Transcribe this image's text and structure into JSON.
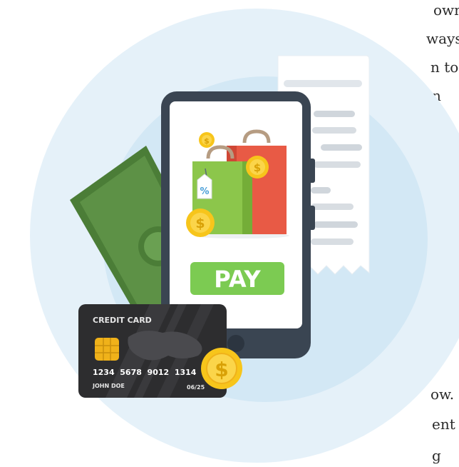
{
  "text_fragments": [
    "own",
    "ways",
    "n to",
    "n",
    "ow.",
    "ent",
    "g"
  ],
  "illustration": {
    "pay_button_label": "PAY",
    "card": {
      "title": "CREDIT CARD",
      "number": "1234  5678  9012  1314",
      "holder": "JOHN DOE",
      "expiry": "06/25"
    },
    "tag_symbol": "%",
    "coin_symbol": "$",
    "colors": {
      "outer_circle": "#e5f1f9",
      "inner_circle": "#d3e8f5",
      "phone_frame": "#3a4552",
      "screen": "#ffffff",
      "pay_button": "#7ccb52",
      "banknote": "#4b7d37",
      "card": "#2d2d2f",
      "coin": "#f7c51b",
      "bag_red": "#e85a45",
      "bag_green": "#8cc64b"
    }
  }
}
